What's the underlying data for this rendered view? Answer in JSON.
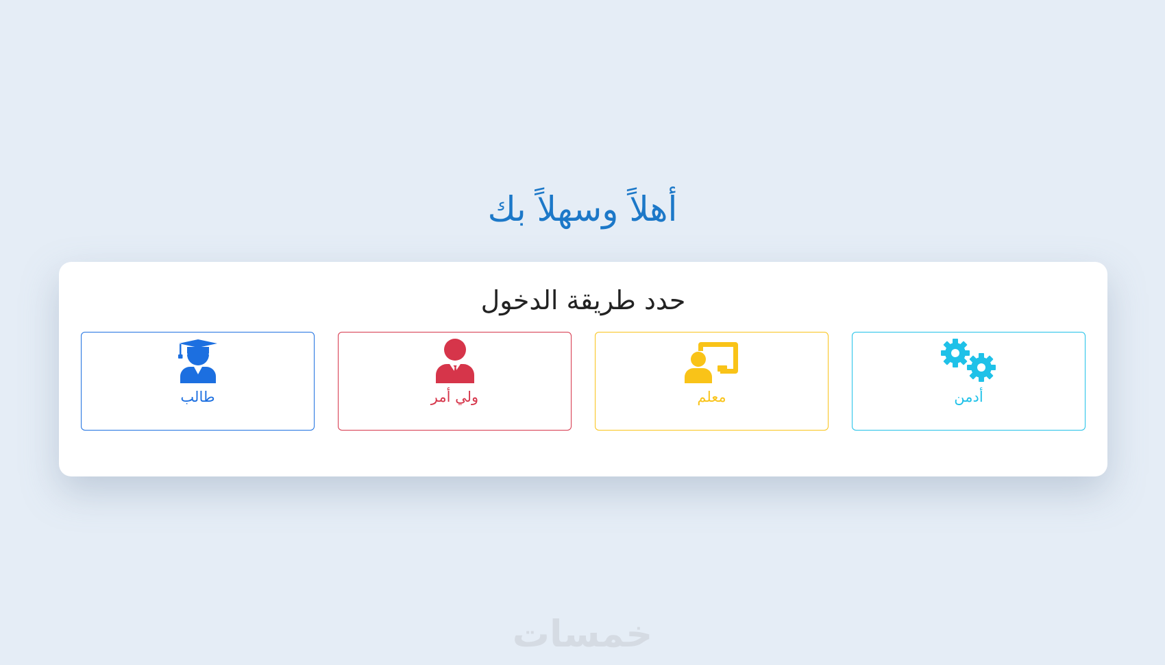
{
  "header": {
    "title": "أهلاً وسهلاً بك"
  },
  "login": {
    "heading": "حدد طريقة الدخول",
    "options": [
      {
        "label": "أدمن",
        "icon": "gears-icon",
        "color": "#1fc1e8"
      },
      {
        "label": "معلم",
        "icon": "teacher-board-icon",
        "color": "#f9c318"
      },
      {
        "label": "ولي أمر",
        "icon": "parent-suit-icon",
        "color": "#d6354a"
      },
      {
        "label": "طالب",
        "icon": "student-graduate-icon",
        "color": "#1c6fe0"
      }
    ]
  },
  "footer": {
    "watermark": "خمسات"
  },
  "colors": {
    "background": "#e5edf6",
    "title": "#1c78c8"
  }
}
